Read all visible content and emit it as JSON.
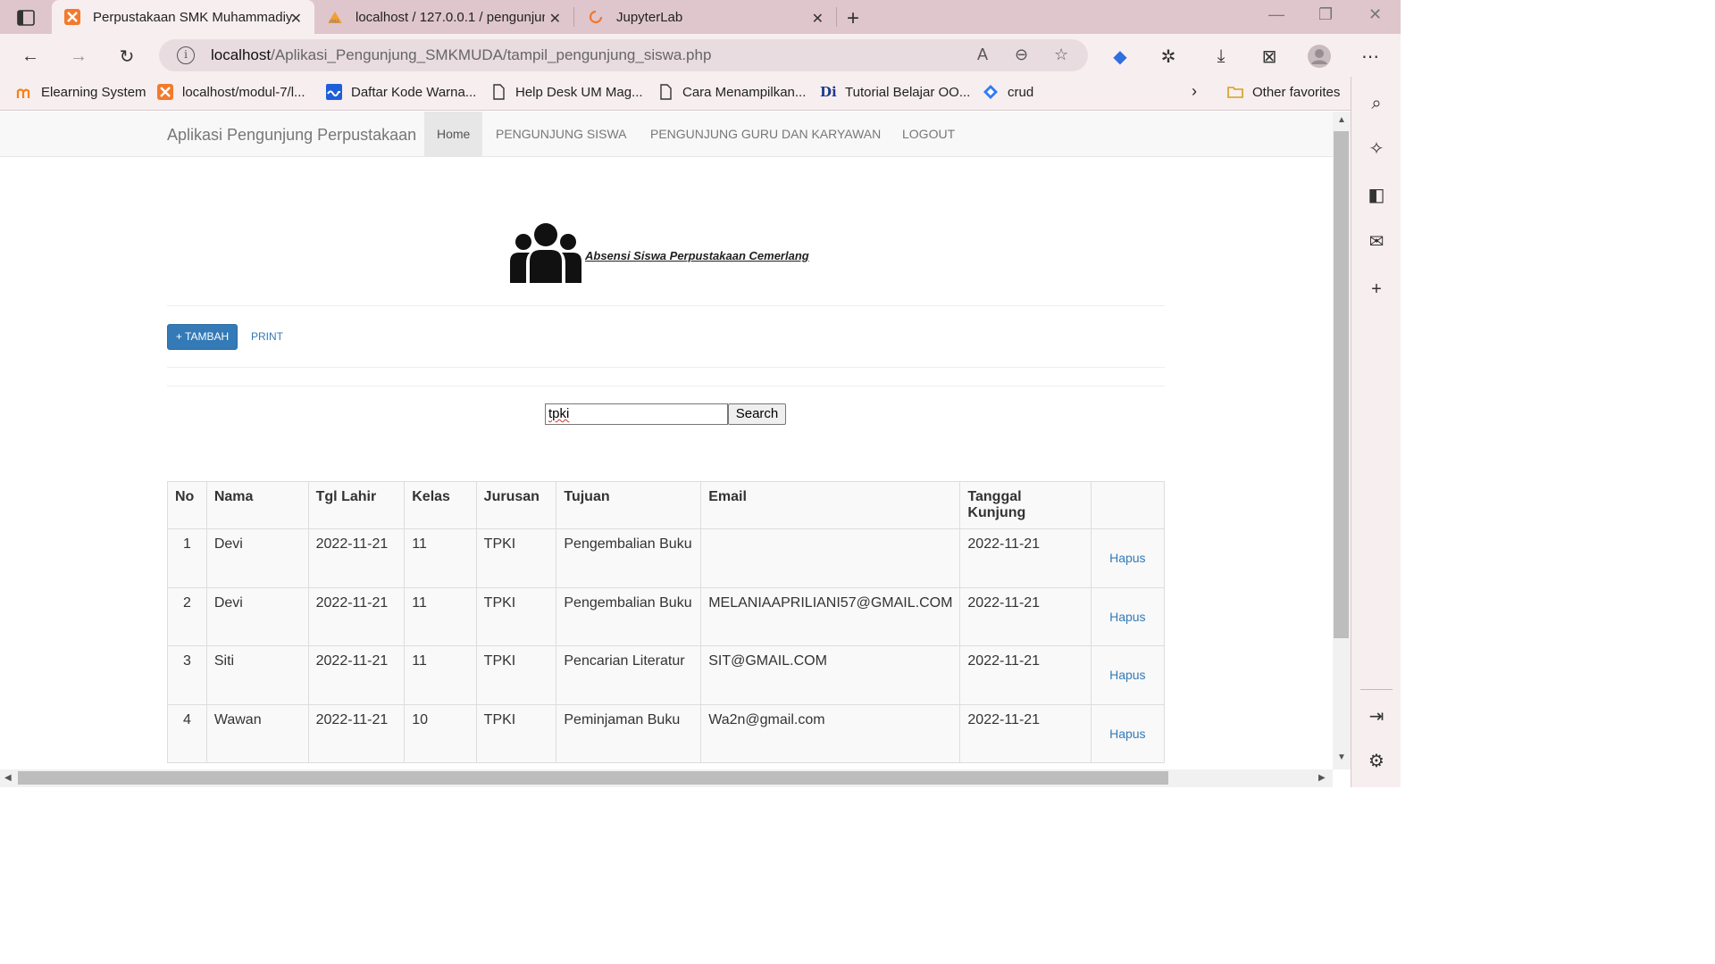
{
  "browser": {
    "tabs": [
      {
        "title": "Perpustakaan SMK Muhammadiy",
        "active": true
      },
      {
        "title": "localhost / 127.0.0.1 / pengunjun",
        "active": false
      },
      {
        "title": "JupyterLab",
        "active": false
      }
    ],
    "url_host": "localhost",
    "url_path": "/Aplikasi_Pengunjung_SMKMUDA/tampil_pengunjung_siswa.php",
    "bookmarks": [
      "Elearning System",
      "localhost/modul-7/l...",
      "Daftar Kode Warna...",
      "Help Desk UM Mag...",
      "Cara Menampilkan...",
      "Tutorial Belajar OO...",
      "crud"
    ],
    "other_favorites": "Other favorites"
  },
  "navbar": {
    "brand": "Aplikasi Pengunjung Perpustakaan",
    "links": [
      "Home",
      "PENGUNJUNG SISWA",
      "PENGUNJUNG GURU DAN KARYAWAN",
      "LOGOUT"
    ]
  },
  "hero": {
    "title": "Absensi Siswa Perpustakaan Cemerlang"
  },
  "actions": {
    "add_label": "+ TAMBAH",
    "print_label": "PRINT"
  },
  "search": {
    "value": "tpki",
    "button_label": "Search"
  },
  "table": {
    "headers": [
      "No",
      "Nama",
      "Tgl Lahir",
      "Kelas",
      "Jurusan",
      "Tujuan",
      "Email",
      "Tanggal Kunjung",
      ""
    ],
    "rows": [
      {
        "no": "1",
        "nama": "Devi",
        "tgl_lahir": "2022-11-21",
        "kelas": "11",
        "jurusan": "TPKI",
        "tujuan": "Pengembalian Buku",
        "email": "",
        "tanggal": "2022-11-21",
        "aksi": "Hapus"
      },
      {
        "no": "2",
        "nama": "Devi",
        "tgl_lahir": "2022-11-21",
        "kelas": "11",
        "jurusan": "TPKI",
        "tujuan": "Pengembalian Buku",
        "email": "MELANIAAPRILIANI57@GMAIL.COM",
        "tanggal": "2022-11-21",
        "aksi": "Hapus"
      },
      {
        "no": "3",
        "nama": "Siti",
        "tgl_lahir": "2022-11-21",
        "kelas": "11",
        "jurusan": "TPKI",
        "tujuan": "Pencarian Literatur",
        "email": "SIT@GMAIL.COM",
        "tanggal": "2022-11-21",
        "aksi": "Hapus"
      },
      {
        "no": "4",
        "nama": "Wawan",
        "tgl_lahir": "2022-11-21",
        "kelas": "10",
        "jurusan": "TPKI",
        "tujuan": "Peminjaman Buku",
        "email": "Wa2n@gmail.com",
        "tanggal": "2022-11-21",
        "aksi": "Hapus"
      }
    ]
  },
  "colors": {
    "primary": "#337ab7",
    "tabstrip": "#dfc6cd",
    "toolbar": "#f7eef0"
  }
}
